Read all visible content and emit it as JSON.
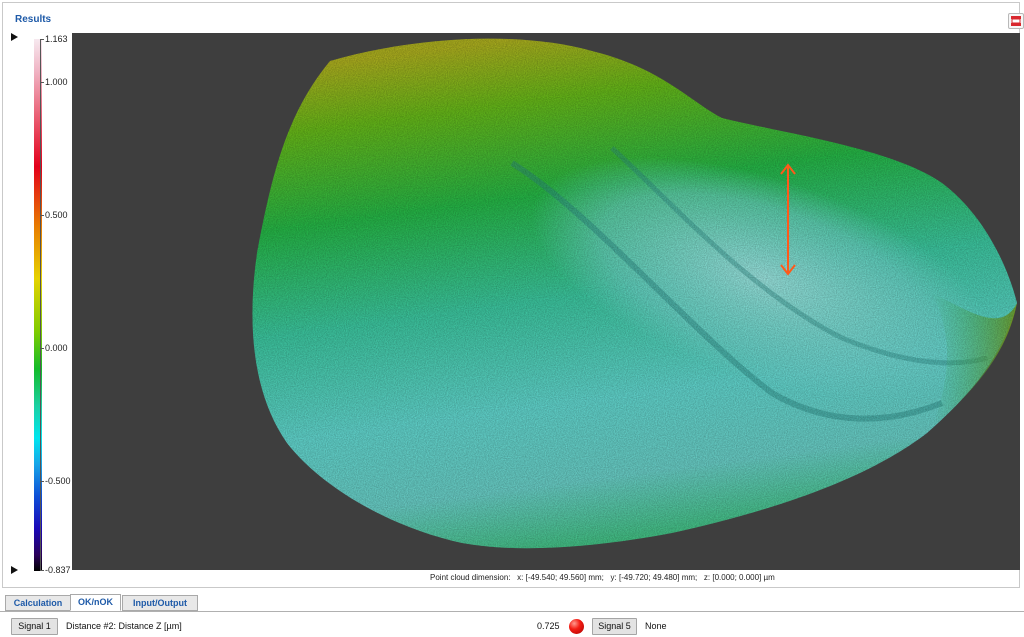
{
  "panel": {
    "title": "Results"
  },
  "toolbar": {
    "export_icon": "export-report-icon"
  },
  "colorbar": {
    "ticks": [
      {
        "value": "1.163",
        "fraction": 0.0
      },
      {
        "value": "1.000",
        "fraction": 0.0815
      },
      {
        "value": "0.500",
        "fraction": 0.3315
      },
      {
        "value": "0.000",
        "fraction": 0.5815
      },
      {
        "value": "-0.500",
        "fraction": 0.8315
      },
      {
        "value": "-0.837",
        "fraction": 1.0
      }
    ],
    "colors": {
      "max": "#f6e9ef",
      "high": "#e3001a",
      "mid_high": "#e6d200",
      "zero": "#13bb2a",
      "mid_low": "#00e5ef",
      "low": "#0d4ed6",
      "min": "#000000"
    }
  },
  "viewport": {
    "background": "#3e3e3e",
    "dimension_text": "Point cloud dimension:   x: [-49.540; 49.560] mm;   y: [-49.720; 49.480] mm;   z: [0.000; 0.000] µm"
  },
  "tabs": [
    {
      "label": "Calculation",
      "active": false
    },
    {
      "label": "OK/nOK",
      "active": true
    },
    {
      "label": "Input/Output",
      "active": false
    }
  ],
  "status": {
    "signal1_label": "Signal 1",
    "distance_label": "Distance #2: Distance Z [µm]",
    "value": "0.725",
    "led_color": "#f41d14",
    "signal5_label": "Signal 5",
    "signal5_value": "None"
  }
}
